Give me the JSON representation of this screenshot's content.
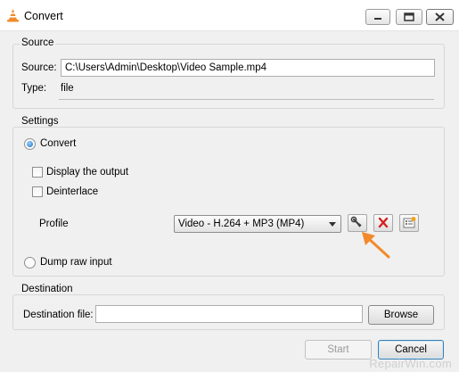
{
  "window": {
    "title": "Convert",
    "controls": {
      "minimize": "minimize-icon",
      "restore": "restore-icon",
      "close": "close-icon"
    }
  },
  "source": {
    "group_label": "Source",
    "source_label": "Source:",
    "source_value": "C:\\Users\\Admin\\Desktop\\Video Sample.mp4",
    "type_label": "Type:",
    "type_value": "file"
  },
  "settings": {
    "group_label": "Settings",
    "convert_label": "Convert",
    "convert_selected": true,
    "display_output_label": "Display the output",
    "display_output_checked": false,
    "deinterlace_label": "Deinterlace",
    "deinterlace_checked": false,
    "profile_label": "Profile",
    "profile_value": "Video - H.264 + MP3 (MP4)",
    "profile_tools": [
      "wrench-icon",
      "delete-icon",
      "new-profile-icon"
    ],
    "dump_raw_label": "Dump raw input",
    "dump_raw_selected": false
  },
  "destination": {
    "group_label": "Destination",
    "file_label": "Destination file:",
    "file_value": "",
    "browse_label": "Browse"
  },
  "footer": {
    "start_label": "Start",
    "cancel_label": "Cancel"
  },
  "watermark": "RepairWin.com",
  "colors": {
    "accent_arrow": "#f28a2b",
    "delete_red": "#d62020",
    "selected_radio": "#1d6fc4"
  }
}
